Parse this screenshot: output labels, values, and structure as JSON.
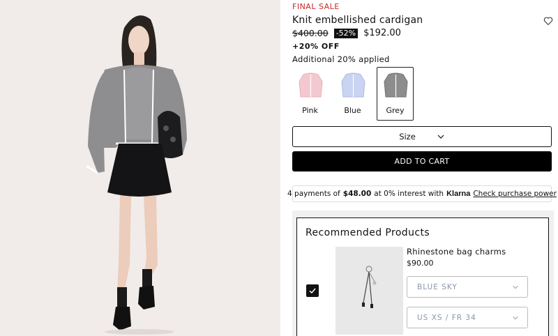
{
  "product": {
    "badge": "FINAL SALE",
    "title": "Knit embellished cardigan",
    "original_price": "$400.00",
    "discount": "-52%",
    "sale_price": "$192.00",
    "extra_off": "+20% OFF",
    "extra_note": "Additional 20% applied"
  },
  "swatches": [
    {
      "label": "Pink",
      "color": "#f3c9cf",
      "selected": false
    },
    {
      "label": "Blue",
      "color": "#c9d3f2",
      "selected": false
    },
    {
      "label": "Grey",
      "color": "#8d8d8d",
      "selected": true
    }
  ],
  "size_select": {
    "label": "Size"
  },
  "add_to_cart": {
    "label": "ADD TO CART"
  },
  "klarna": {
    "prefix": "4 payments of",
    "amount": "$48.00",
    "suffix": "at 0% interest with",
    "brand": "Klarna",
    "link": "Check purchase power"
  },
  "recommended": {
    "heading": "Recommended Products",
    "item": {
      "name": "Rhinestone bag charms",
      "price": "$90.00",
      "color_value": "BLUE SKY",
      "size_value": "US XS / FR 34",
      "checked": true
    }
  },
  "icons": {
    "wishlist": "heart-icon",
    "dropdown": "chevron-down-icon",
    "check": "checkmark-icon"
  }
}
